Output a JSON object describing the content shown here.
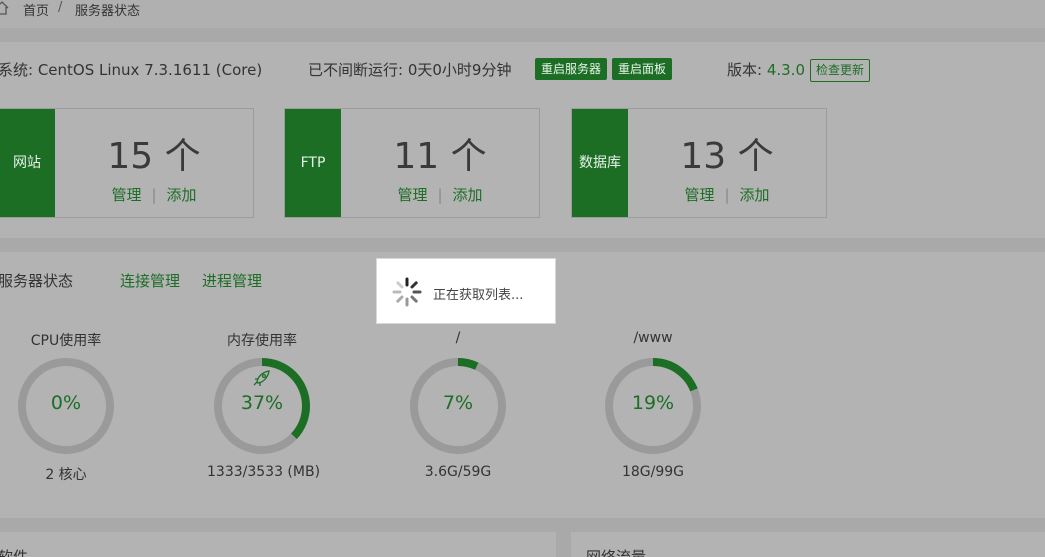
{
  "breadcrumb": {
    "home": "首页",
    "separator": "/",
    "current": "服务器状态"
  },
  "sysinfo": {
    "os": "系统: CentOS Linux 7.3.1611 (Core)",
    "uptime": "已不间断运行: 0天0小时9分钟",
    "restart_server": "重启服务器",
    "restart_panel": "重启面板",
    "version_label": "版本: ",
    "version": "4.3.0",
    "check_update": "检查更新"
  },
  "cards": [
    {
      "tag": "网站",
      "count": "15 个",
      "manage": "管理",
      "add": "添加"
    },
    {
      "tag": "FTP",
      "count": "11 个",
      "manage": "管理",
      "add": "添加"
    },
    {
      "tag": "数据库",
      "count": "13 个",
      "manage": "管理",
      "add": "添加"
    }
  ],
  "status": {
    "title": "服务器状态",
    "link_connections": "连接管理",
    "link_processes": "进程管理",
    "gauges": [
      {
        "label": "CPU使用率",
        "value": "0%",
        "percent": 0,
        "sub": "2 核心"
      },
      {
        "label": "内存使用率",
        "value": "37%",
        "percent": 37,
        "sub": "1333/3533 (MB)"
      },
      {
        "label": "/",
        "value": "7%",
        "percent": 7,
        "sub": "3.6G/59G"
      },
      {
        "label": "/www",
        "value": "19%",
        "percent": 19,
        "sub": "18G/99G"
      }
    ]
  },
  "bottom": {
    "left_title": "软件",
    "right_title": "网络流量"
  },
  "loading": {
    "text": "正在获取列表..."
  },
  "colors": {
    "accent": "#1c6e25",
    "overlay": "#a9a9a9",
    "ring": "#9a9a9a"
  }
}
